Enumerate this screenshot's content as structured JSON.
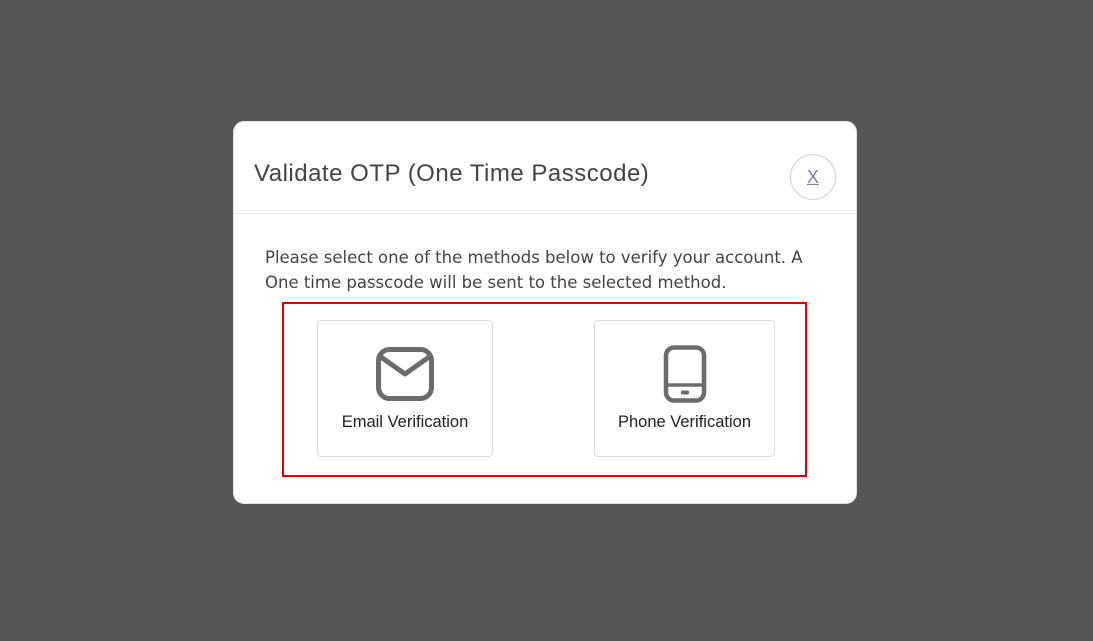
{
  "modal": {
    "title": "Validate OTP (One Time Passcode)",
    "close_label": "X",
    "instructions": "Please select one of the methods below to verify your account. A One time passcode will be sent to the selected method."
  },
  "methods": [
    {
      "label": "Email Verification",
      "icon": "envelope-icon"
    },
    {
      "label": "Phone Verification",
      "icon": "mobile-phone-icon"
    }
  ],
  "colors": {
    "overlay": "#575757",
    "highlight_border": "#e00000",
    "icon_stroke": "#6b6b6b"
  }
}
